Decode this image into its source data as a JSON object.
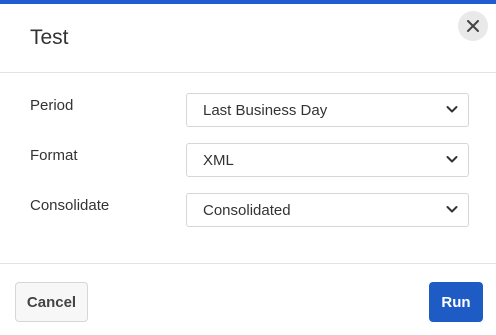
{
  "dialog": {
    "title": "Test",
    "accent_color": "#1f5bd1",
    "close_icon": "close-icon"
  },
  "form": {
    "fields": [
      {
        "label": "Period",
        "value": "Last Business Day"
      },
      {
        "label": "Format",
        "value": "XML"
      },
      {
        "label": "Consolidate",
        "value": "Consolidated"
      }
    ]
  },
  "footer": {
    "cancel_label": "Cancel",
    "run_label": "Run",
    "run_color": "#1f5bc4"
  }
}
